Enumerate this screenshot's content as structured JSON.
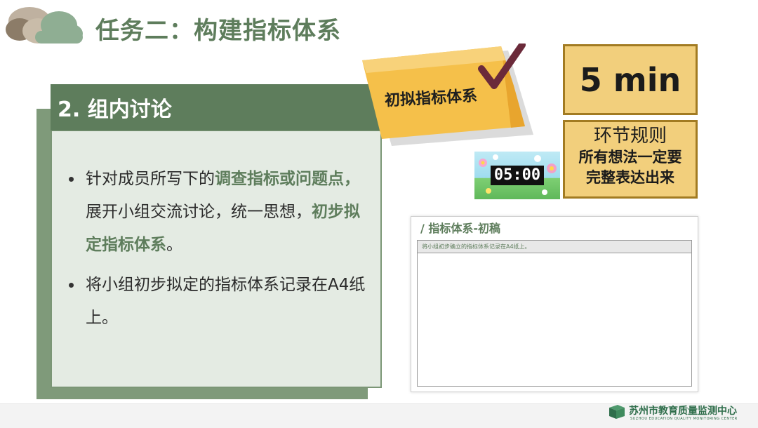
{
  "title": "任务二：构建指标体系",
  "card": {
    "title": "2. 组内讨论",
    "bullets": [
      {
        "segments": [
          {
            "text": "针对成员所写下的",
            "highlight": false
          },
          {
            "text": "调查指标或问题点，",
            "highlight": true
          },
          {
            "text": "展开小组交流讨论，统一思想，",
            "highlight": false
          },
          {
            "text": "初步拟定指标体系",
            "highlight": true
          },
          {
            "text": "。",
            "highlight": false
          }
        ]
      },
      {
        "segments": [
          {
            "text": "将小组初步拟定的指标体系记录在A4纸上。",
            "highlight": false
          }
        ]
      }
    ]
  },
  "sticky": {
    "label": "初拟指标体系"
  },
  "time_box": {
    "label": "5 min"
  },
  "rule_box": {
    "title": "环节规则",
    "lines": [
      "所有想法一定要",
      "完整表达出来"
    ]
  },
  "timer": {
    "display": "05:00"
  },
  "worksheet": {
    "title": "/ 指标体系-初稿",
    "instruction": "将小组初步确立的指标体系记录在A4纸上。"
  },
  "footer": {
    "org": "苏州市教育质量监测中心",
    "org_en": "SUZHOU EDUCATION QUALITY MONITORING CENTER"
  },
  "colors": {
    "accent_green": "#5e7d5c",
    "card_bg": "#e4ebe3",
    "gold": "#f2cf7c",
    "gold_border": "#a27b22",
    "check": "#6b2a3a"
  },
  "icons": [
    "cloud-icon",
    "check-mark-icon",
    "flower-icon",
    "book-icon"
  ]
}
